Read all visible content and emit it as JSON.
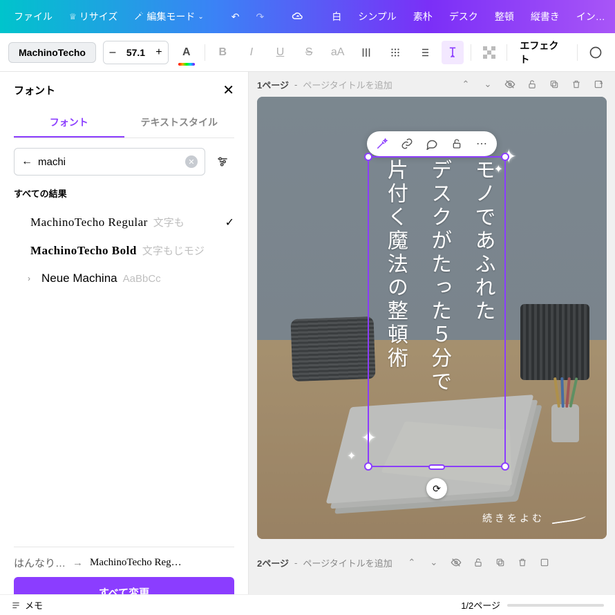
{
  "menubar": {
    "file": "ファイル",
    "resize": "リサイズ",
    "edit_mode": "編集モード",
    "templates": [
      "白",
      "シンプル",
      "素朴",
      "デスク",
      "整頓",
      "縦書き",
      "イン…"
    ]
  },
  "toolbar": {
    "font_name": "MachinoTecho",
    "size": "57.1",
    "effect_label": "エフェクト"
  },
  "font_panel": {
    "title": "フォント",
    "tab_font": "フォント",
    "tab_style": "テキストスタイル",
    "search_value": "machi",
    "section_all": "すべての結果",
    "items": [
      {
        "name": "MachinoTecho Regular",
        "sample": "文字も",
        "selected": true,
        "machino": true
      },
      {
        "name": "MachinoTecho Bold",
        "sample": "文字もじモジ",
        "selected": false,
        "machino": true
      },
      {
        "name": "Neue Machina",
        "sample": "AaBbCc",
        "selected": false,
        "expandable": true
      }
    ],
    "replace_from": "はんなり…",
    "replace_to": "MachinoTecho Reg…",
    "apply_all": "すべて変更"
  },
  "pages": {
    "p1_label": "1ページ",
    "p2_label": "2ページ",
    "title_placeholder": "ページタイトルを追加"
  },
  "canvas_text": {
    "line1": "モノであふれた",
    "line2": "デスクがたった５分で",
    "line3": "片付く魔法の整頓術",
    "read_more": "続きをよむ"
  },
  "footer": {
    "memo": "メモ",
    "page_indicator": "1/2ページ"
  }
}
